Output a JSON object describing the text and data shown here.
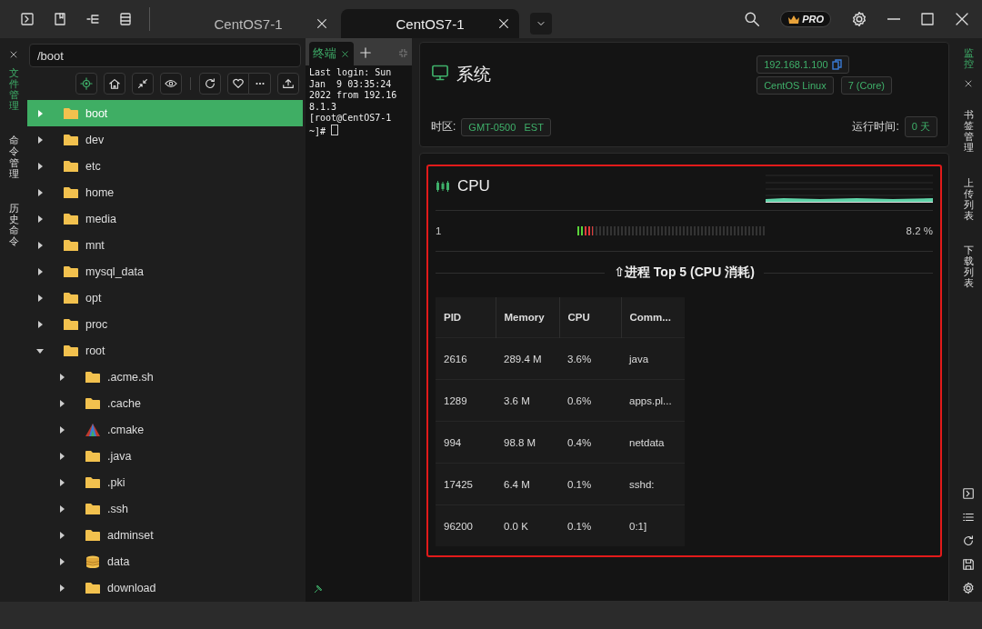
{
  "pro_badge": "PRO",
  "tabs": [
    {
      "label": "CentOS7-1",
      "selected": false
    },
    {
      "label": "CentOS7-1",
      "selected": true
    }
  ],
  "left_strip": [
    {
      "label": "文件管理",
      "selected": true
    },
    {
      "label": "命令管理",
      "selected": false
    },
    {
      "label": "历史命令",
      "selected": false
    }
  ],
  "file_panel": {
    "path": "/boot",
    "tree": [
      {
        "name": "boot",
        "kind": "folder",
        "selected": true,
        "expanded": false
      },
      {
        "name": "dev",
        "kind": "folder",
        "selected": false,
        "expanded": false
      },
      {
        "name": "etc",
        "kind": "folder",
        "selected": false,
        "expanded": false
      },
      {
        "name": "home",
        "kind": "folder",
        "selected": false,
        "expanded": false
      },
      {
        "name": "media",
        "kind": "folder",
        "selected": false,
        "expanded": false
      },
      {
        "name": "mnt",
        "kind": "folder",
        "selected": false,
        "expanded": false
      },
      {
        "name": "mysql_data",
        "kind": "folder",
        "selected": false,
        "expanded": false
      },
      {
        "name": "opt",
        "kind": "folder",
        "selected": false,
        "expanded": false
      },
      {
        "name": "proc",
        "kind": "folder",
        "selected": false,
        "expanded": false
      },
      {
        "name": "root",
        "kind": "folder",
        "selected": false,
        "expanded": true,
        "children": [
          {
            "name": ".acme.sh",
            "kind": "folder",
            "selected": false,
            "expanded": false
          },
          {
            "name": ".cache",
            "kind": "folder",
            "selected": false,
            "expanded": false
          },
          {
            "name": ".cmake",
            "kind": "app",
            "selected": false,
            "expanded": false
          },
          {
            "name": ".java",
            "kind": "folder",
            "selected": false,
            "expanded": false
          },
          {
            "name": ".pki",
            "kind": "folder",
            "selected": false,
            "expanded": false
          },
          {
            "name": ".ssh",
            "kind": "folder",
            "selected": false,
            "expanded": false
          },
          {
            "name": "adminset",
            "kind": "folder",
            "selected": false,
            "expanded": false
          },
          {
            "name": "data",
            "kind": "stack",
            "selected": false,
            "expanded": false
          },
          {
            "name": "download",
            "kind": "folder",
            "selected": false,
            "expanded": false
          }
        ]
      }
    ]
  },
  "terminal": {
    "tab": "终端",
    "lines": [
      "Last login: Sun",
      "Jan  9 03:35:24",
      "2022 from 192.16",
      "8.1.3",
      "[root@CentOS7-1",
      "~]# "
    ]
  },
  "system": {
    "title": "系统",
    "ip": "192.168.1.100",
    "os": "CentOS Linux",
    "version": "7 (Core)",
    "timezone_label": "时区:",
    "timezone": "GMT-0500   EST",
    "uptime_label": "运行时间:",
    "uptime": "0 天"
  },
  "cpu": {
    "title": "CPU",
    "cores": [
      {
        "name": "1",
        "level": 0.08,
        "reading": "8.2 %"
      }
    ],
    "top_title": "⇧进程 Top 5 (CPU 消耗)",
    "columns": [
      "PID",
      "Memory",
      "CPU",
      "Comm..."
    ],
    "rows": [
      [
        "2616",
        "289.4 M",
        "3.6%",
        "java"
      ],
      [
        "1289",
        "3.6 M",
        "0.6%",
        "apps.pl..."
      ],
      [
        "994",
        "98.8 M",
        "0.4%",
        "netdata"
      ],
      [
        "17425",
        "6.4 M",
        "0.1%",
        "sshd:"
      ],
      [
        "96200",
        "0.0 K",
        "0.1%",
        "0:1]"
      ]
    ]
  },
  "right_strip": [
    {
      "label": "监控",
      "selected": true
    },
    {
      "label": "书签管理",
      "selected": false
    },
    {
      "label": "上传列表",
      "selected": false
    },
    {
      "label": "下载列表",
      "selected": false
    }
  ]
}
